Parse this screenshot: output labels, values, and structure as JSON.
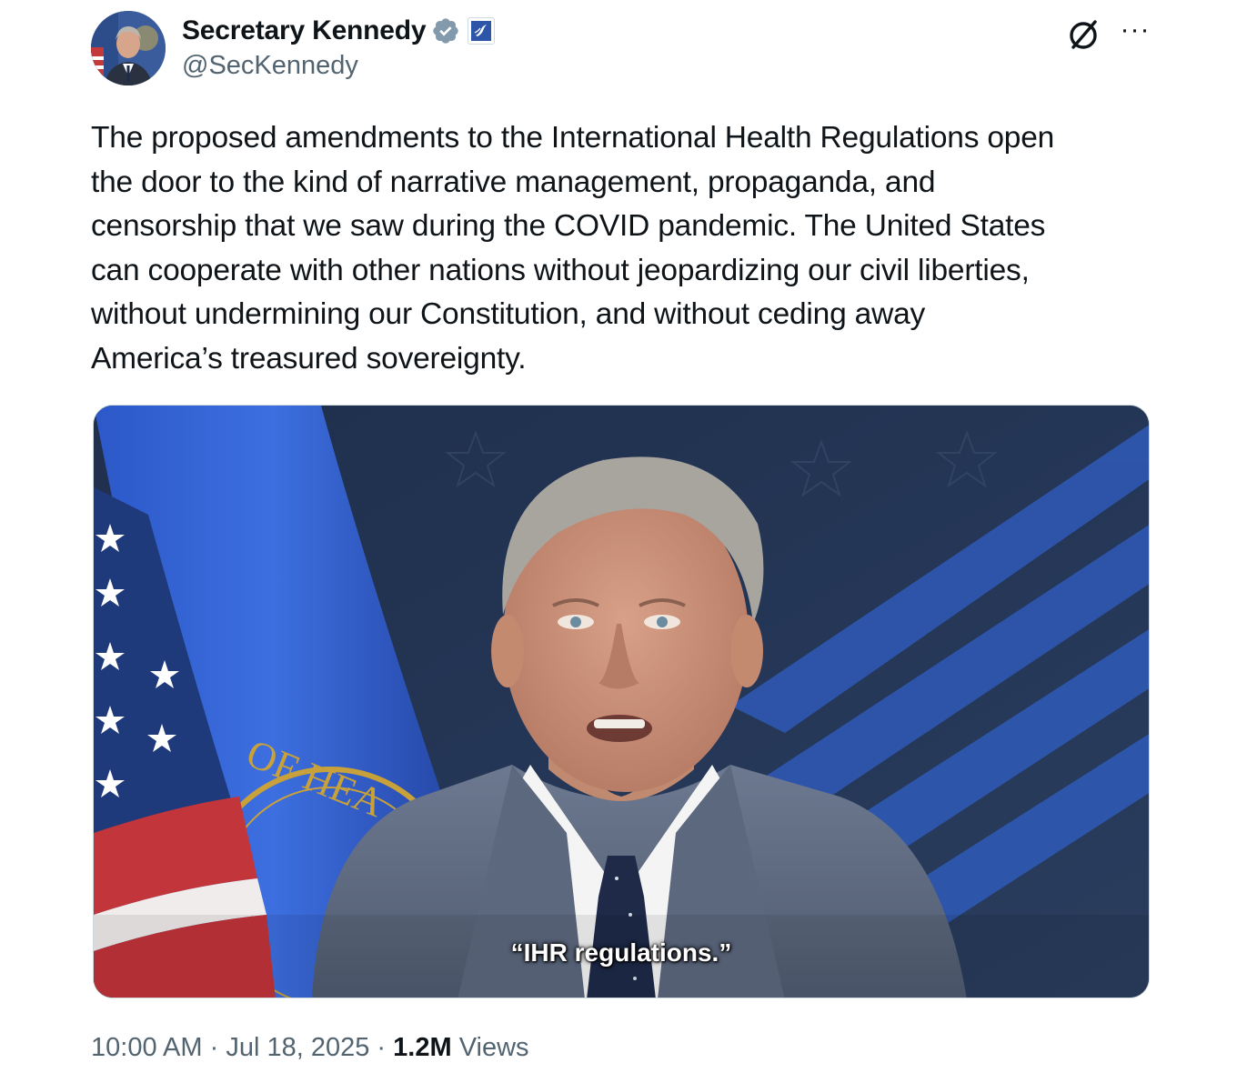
{
  "author": {
    "display_name": "Secretary Kennedy",
    "handle": "@SecKennedy",
    "avatar_icon": "profile-photo",
    "verified_icon": "verified-badge-icon",
    "affiliate_icon": "hhs-affiliate-badge-icon",
    "verified_color": "#829aab"
  },
  "header_actions": {
    "grok_icon": "grok-icon",
    "more_icon": "more-options-icon",
    "more_glyph": "···"
  },
  "tweet": {
    "text": "The proposed amendments to the International Health Regulations open\nthe door to the kind of narrative management, propaganda, and\ncensorship that we saw during the COVID pandemic. The United States\ncan cooperate with other nations without jeopardizing our civil liberties,\nwithout undermining our Constitution, and without ceding away\nAmerica’s treasured sovereignty."
  },
  "media": {
    "type": "video",
    "caption": "“IHR regulations.”",
    "seal_text": "OF HEA"
  },
  "meta": {
    "time": "10:00 AM",
    "separator": "·",
    "date": "Jul 18, 2025",
    "views_count": "1.2M",
    "views_label": "Views"
  }
}
